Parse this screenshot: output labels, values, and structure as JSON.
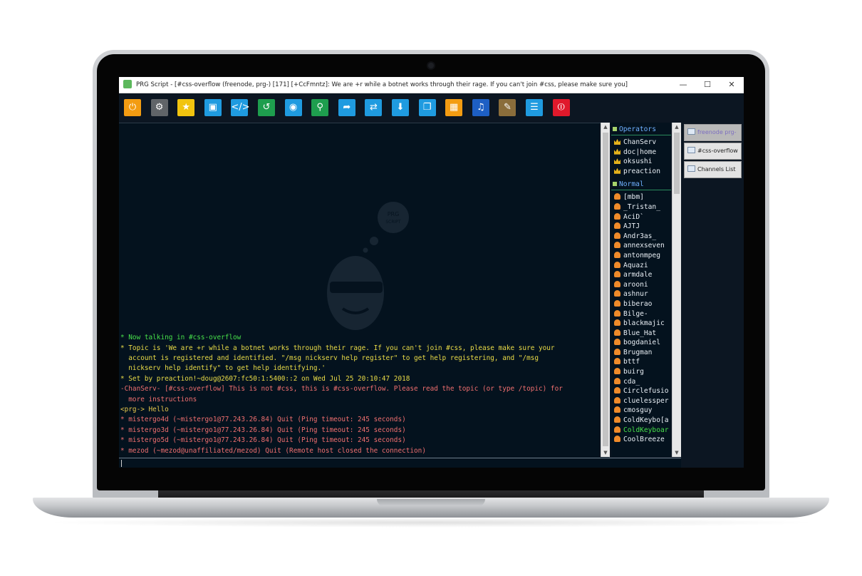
{
  "window": {
    "title": "PRG Script - [#css-overflow (freenode, prg-) [171] [+CcFmntz]: We are +r while a botnet works through their rage. If you can't join #css, please make sure you]",
    "minimize": "—",
    "maximize": "☐",
    "close": "✕"
  },
  "toolbar": {
    "buttons": [
      {
        "name": "power-icon",
        "glyph": "⏻",
        "color": "#f39c12"
      },
      {
        "name": "gear-icon",
        "glyph": "⚙",
        "color": "#606468"
      },
      {
        "name": "star-icon",
        "glyph": "★",
        "color": "#f1c40f"
      },
      {
        "name": "window-icon",
        "glyph": "▣",
        "color": "#1f9be0"
      },
      {
        "name": "code-icon",
        "glyph": "</>",
        "color": "#1f9be0"
      },
      {
        "name": "history-icon",
        "glyph": "↺",
        "color": "#1e9e4e"
      },
      {
        "name": "eye-icon",
        "glyph": "◉",
        "color": "#1f9be0"
      },
      {
        "name": "search-icon",
        "glyph": "⚲",
        "color": "#1e9e4e"
      },
      {
        "name": "share-icon",
        "glyph": "➦",
        "color": "#1f9be0"
      },
      {
        "name": "transfer-icon",
        "glyph": "⇄",
        "color": "#1f9be0"
      },
      {
        "name": "download-icon",
        "glyph": "⬇",
        "color": "#1f9be0"
      },
      {
        "name": "copy-icon",
        "glyph": "❐",
        "color": "#1f9be0"
      },
      {
        "name": "grid-icon",
        "glyph": "▦",
        "color": "#f39c12"
      },
      {
        "name": "music-icon",
        "glyph": "♫",
        "color": "#1d5fc4"
      },
      {
        "name": "edit-icon",
        "glyph": "✎",
        "color": "#8a6d3b"
      },
      {
        "name": "list-icon",
        "glyph": "☰",
        "color": "#1f9be0"
      },
      {
        "name": "shutdown-icon",
        "glyph": "⏼",
        "color": "#e0192b"
      }
    ]
  },
  "watermark": {
    "line1": "PRG",
    "line2": "SCRIPT"
  },
  "chat": {
    "lines": [
      {
        "cls": "green",
        "text": "* Now talking in #css-overflow"
      },
      {
        "cls": "yellow",
        "text": "* Topic is 'We are +r while a botnet works through their rage. If you can't join #css, please make sure your"
      },
      {
        "cls": "yellow",
        "text": "  account is registered and identified. \"/msg nickserv help register\" to get help registering, and \"/msg"
      },
      {
        "cls": "yellow",
        "text": "  nickserv help identify\" to get help identifying.'"
      },
      {
        "cls": "yellow",
        "text": "* Set by preaction!~doug@2607:fc50:1:5400::2 on Wed Jul 25 20:10:47 2018"
      },
      {
        "cls": "pink",
        "text": "-ChanServ- [#css-overflow] This is not #css, this is #css-overflow. Please read the topic (or type /topic) for"
      },
      {
        "cls": "pink",
        "text": "  more instructions"
      },
      {
        "cls": "gold",
        "text": "<prg-> Hello"
      },
      {
        "cls": "pink",
        "text": "* mistergo4d (~mistergo1@77.243.26.84) Quit (Ping timeout: 245 seconds)"
      },
      {
        "cls": "pink",
        "text": "* mistergo3d (~mistergo1@77.243.26.84) Quit (Ping timeout: 245 seconds)"
      },
      {
        "cls": "pink",
        "text": "* mistergo5d (~mistergo1@77.243.26.84) Quit (Ping timeout: 245 seconds)"
      },
      {
        "cls": "pink",
        "text": "* mezod (~mezod@unaffiliated/mezod) Quit (Remote host closed the connection)"
      }
    ]
  },
  "nicklist": {
    "operators_label": "Operators",
    "operators": [
      "ChanServ",
      "doc|home",
      "oksushi",
      "preaction"
    ],
    "normal_label": "Normal",
    "normal": [
      "[mbm]",
      "_Tristan_",
      "AciD`",
      "AJTJ",
      "Andr3as_",
      "annexseven",
      "antonmpeg",
      "Aquazi",
      "armdale",
      "arooni",
      "ashnur",
      "biberao",
      "Bilge-",
      "blackmajic",
      "Blue_Hat",
      "bogdaniel",
      "Brugman",
      "bttf",
      "buirg",
      "cda_",
      "Circlefusio",
      "cluelessper",
      "cmosguy",
      "ColdKeybo[a",
      "ColdKeyboar",
      "CoolBreeze"
    ],
    "highlight_nick": "ColdKeyboar",
    "highlight_color": "#47e04a"
  },
  "tabs": [
    {
      "label": "freenode prg-",
      "active": true
    },
    {
      "label": "#css-overflow",
      "active": false
    },
    {
      "label": "Channels List",
      "active": false
    }
  ]
}
